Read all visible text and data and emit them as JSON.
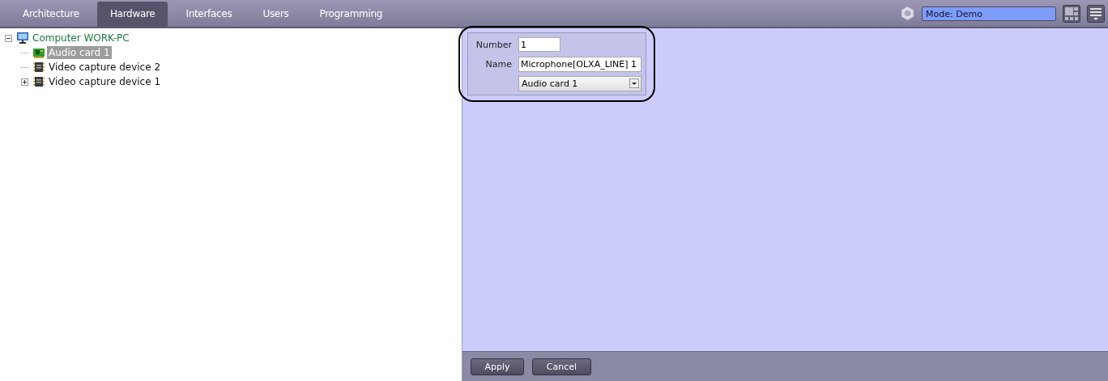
{
  "tabs": [
    {
      "label": "Architecture",
      "selected": false
    },
    {
      "label": "Hardware",
      "selected": true
    },
    {
      "label": "Interfaces",
      "selected": false
    },
    {
      "label": "Users",
      "selected": false
    },
    {
      "label": "Programming",
      "selected": false
    }
  ],
  "mode_field": {
    "value": "Mode: Demo"
  },
  "tree": [
    {
      "label": "Computer WORK-PC",
      "kind": "computer",
      "selected": false,
      "expanded": true,
      "children": [
        {
          "label": "Audio card 1",
          "kind": "audio",
          "selected": true
        },
        {
          "label": "Video capture device 2",
          "kind": "video",
          "selected": false
        },
        {
          "label": "Video capture device 1",
          "kind": "video",
          "selected": false,
          "expanded": false
        }
      ]
    }
  ],
  "form": {
    "number_label": "Number",
    "number_value": "1",
    "name_label": "Name",
    "name_value": "Microphone[OLXA_LINE] 1",
    "device_value": "Audio card 1"
  },
  "buttons": [
    "Apply",
    "Cancel"
  ]
}
